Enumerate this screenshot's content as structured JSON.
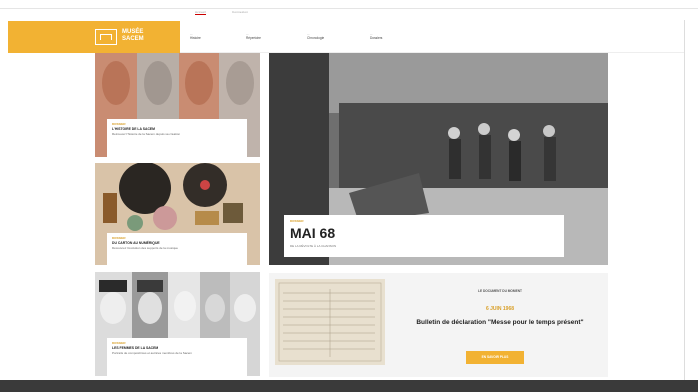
{
  "top_links": [
    "Accueil",
    "Connexion"
  ],
  "logo": {
    "line1": "MUSÉE",
    "line2": "SACEM"
  },
  "nav": [
    {
      "over": "—",
      "label": "Histoire"
    },
    {
      "over": "—",
      "label": "Répertoire"
    },
    {
      "over": "—",
      "label": "Chronologie"
    },
    {
      "over": "—",
      "label": "Dossiers"
    }
  ],
  "cards": [
    {
      "eyebrow": "DOSSIER",
      "title": "L'HISTOIRE DE LA SACEM",
      "text": "Retrouvez l'histoire de la Sacem depuis sa création"
    },
    {
      "eyebrow": "DOSSIER",
      "title": "DU CARTON AU NUMÉRIQUE",
      "text": "Découvrez l'évolution des supports de la musique"
    },
    {
      "eyebrow": "DOSSIER",
      "title": "LES FEMMES DE LA SACEM",
      "text": "Portraits de compositrices et autrices membres de la Sacem"
    }
  ],
  "hero": {
    "eyebrow": "DOSSIER",
    "title": "MAI 68",
    "subtitle": "DE LA RÉVOLTE À LA CHANSON"
  },
  "document": {
    "eyebrow": "LE DOCUMENT DU MOMENT",
    "date": "6 JUIN 1968",
    "title": "Bulletin de déclaration \"Messe pour le temps présent\"",
    "button": "EN SAVOIR PLUS"
  },
  "colors": {
    "accent": "#f2b233",
    "footer": "#3a3a3a"
  }
}
